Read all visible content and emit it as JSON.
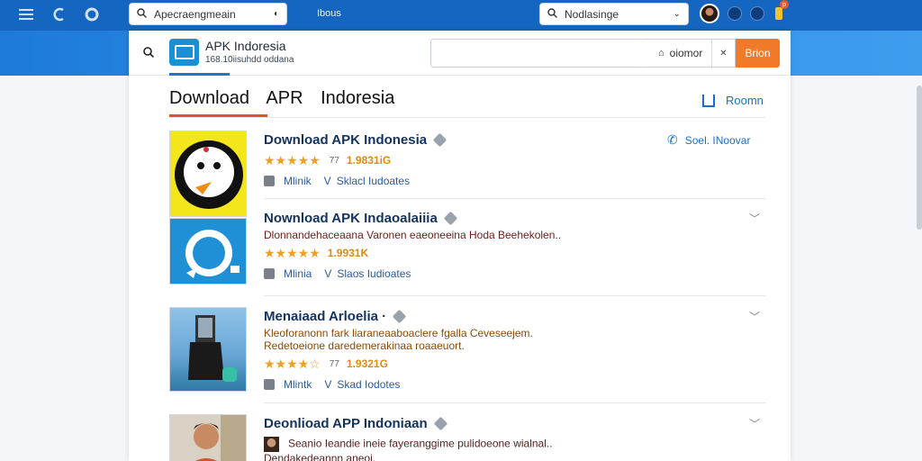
{
  "browser": {
    "search_left": {
      "placeholder": "Apecraengmeain"
    },
    "tab_label": "Ibous",
    "search_right": {
      "placeholder": "Nodlasinge"
    },
    "notification_count": "p"
  },
  "header": {
    "brand_name": "APK Indoresia",
    "brand_sub": "168.10iisuhdd oddana",
    "dropdown_label": "oiomor",
    "button_label": "Brion"
  },
  "page": {
    "title_words": [
      "Download",
      "APR",
      "Indoresia"
    ],
    "room_link": "Roomn"
  },
  "apps": [
    {
      "title": "Download APK Indonesia",
      "description": "",
      "stars": "★★★★★",
      "rating_count": "77",
      "size": "1.9831iG",
      "meta_a": "Mlinik",
      "meta_b": "Sklacl Iudoates",
      "action": "Soel. INoovar"
    },
    {
      "title": "Nownload APK Indaoalaiiia",
      "description": "Dlonnandehaceaana Varonen eaeoneeina Hoda Beehekolen..",
      "stars": "★★★★★",
      "rating_count": "",
      "size": "1.9931K",
      "meta_a": "Mlinia",
      "meta_b": "Slaos Iudioates",
      "action": ""
    },
    {
      "title": "Menaiaad Arloelia ·",
      "description": "Kleoforanonn fark liaraneaaboaclere fgalla Ceveseejem. Redetoeione daredemerakinaa roaaeuort.",
      "stars": "★★★★☆",
      "rating_count": "77",
      "size": "1.9321G",
      "meta_a": "Mlintk",
      "meta_b": "Skad Iodotes",
      "action": ""
    },
    {
      "title": "Deonlioad APP Indoniaan",
      "description": "Seanio Ieandie ineie fayeranggime pulidoeone wialnal.. Dendakedeannn aneoi.",
      "stars": "",
      "rating_count": "",
      "size": "",
      "meta_a": "",
      "meta_b": "",
      "action": ""
    }
  ],
  "colors": {
    "brand_blue": "#1566c0",
    "accent_orange": "#f07a2a",
    "title_navy": "#13325e",
    "star_gold": "#f0a020"
  }
}
